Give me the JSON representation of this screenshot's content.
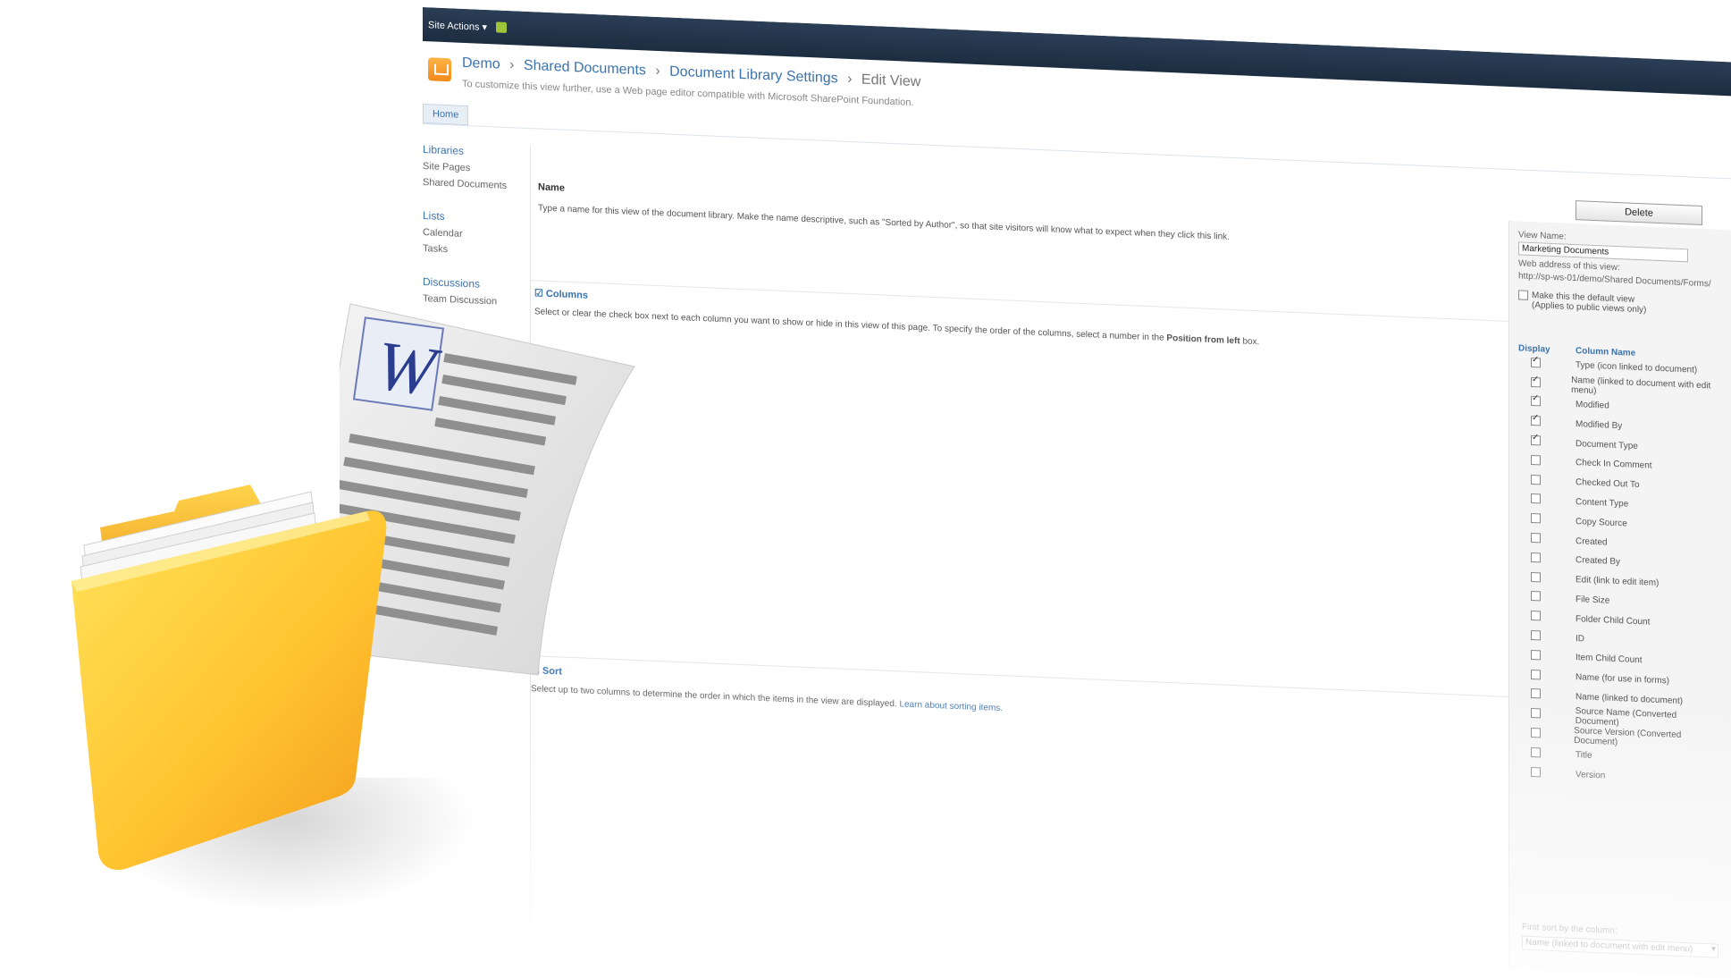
{
  "ribbon": {
    "site_actions": "Site Actions ▾"
  },
  "breadcrumb": {
    "site": "Demo",
    "library": "Shared Documents",
    "settings": "Document Library Settings",
    "current": "Edit View",
    "separator": "›"
  },
  "page_description": "To customize this view further, use a Web page editor compatible with Microsoft SharePoint Foundation.",
  "top_tab": "Home",
  "left_nav": {
    "groups": [
      {
        "heading": "Libraries",
        "items": [
          "Site Pages",
          "Shared Documents"
        ]
      },
      {
        "heading": "Lists",
        "items": [
          "Calendar",
          "Tasks"
        ]
      },
      {
        "heading": "Discussions",
        "items": [
          "Team Discussion"
        ]
      }
    ]
  },
  "delete_button": "Delete",
  "name_section": {
    "title": "Name",
    "description": "Type a name for this view of the document library. Make the name descriptive, such as \"Sorted by Author\", so that site visitors will know what to expect when they click this link."
  },
  "columns_section": {
    "title": "Columns",
    "description_prefix": "Select or clear the check box next to each column you want to show or hide in this view of this page. To specify the order of the columns, select a number in the",
    "description_bold": "Position from left",
    "description_suffix": "box."
  },
  "sort_section": {
    "title": "Sort",
    "description": "Select up to two columns to determine the order in which the items in the view are displayed.",
    "link": "Learn about sorting items."
  },
  "view_panel": {
    "view_name_label": "View Name:",
    "view_name_value": "Marketing Documents",
    "web_address_label": "Web address of this view:",
    "web_address_value": "http://sp-ws-01/demo/Shared Documents/Forms/",
    "default_view_label": "Make this the default view",
    "default_view_note": "(Applies to public views only)",
    "default_view_checked": false
  },
  "column_table": {
    "headers": {
      "display": "Display",
      "column_name": "Column Name"
    },
    "rows": [
      {
        "name": "Type (icon linked to document)",
        "checked": true
      },
      {
        "name": "Name (linked to document with edit menu)",
        "checked": true
      },
      {
        "name": "Modified",
        "checked": true
      },
      {
        "name": "Modified By",
        "checked": true
      },
      {
        "name": "Document Type",
        "checked": true
      },
      {
        "name": "Check In Comment",
        "checked": false
      },
      {
        "name": "Checked Out To",
        "checked": false
      },
      {
        "name": "Content Type",
        "checked": false
      },
      {
        "name": "Copy Source",
        "checked": false
      },
      {
        "name": "Created",
        "checked": false
      },
      {
        "name": "Created By",
        "checked": false
      },
      {
        "name": "Edit (link to edit item)",
        "checked": false
      },
      {
        "name": "File Size",
        "checked": false
      },
      {
        "name": "Folder Child Count",
        "checked": false
      },
      {
        "name": "ID",
        "checked": false
      },
      {
        "name": "Item Child Count",
        "checked": false
      },
      {
        "name": "Name (for use in forms)",
        "checked": false
      },
      {
        "name": "Name (linked to document)",
        "checked": false
      },
      {
        "name": "Source Name (Converted Document)",
        "checked": false
      },
      {
        "name": "Source Version (Converted Document)",
        "checked": false
      },
      {
        "name": "Title",
        "checked": false
      },
      {
        "name": "Version",
        "checked": false
      }
    ]
  },
  "sort_panel": {
    "first_sort_label": "First sort by the column:",
    "first_sort_value": "Name (linked to document with edit menu)"
  },
  "doc_art": {
    "icon_letter": "W"
  },
  "colors": {
    "ribbon": "#1d2d41",
    "link": "#3b73af",
    "folder_light": "#ffd54a",
    "folder_dark": "#f5a623",
    "word_blue": "#2a3d8f"
  }
}
